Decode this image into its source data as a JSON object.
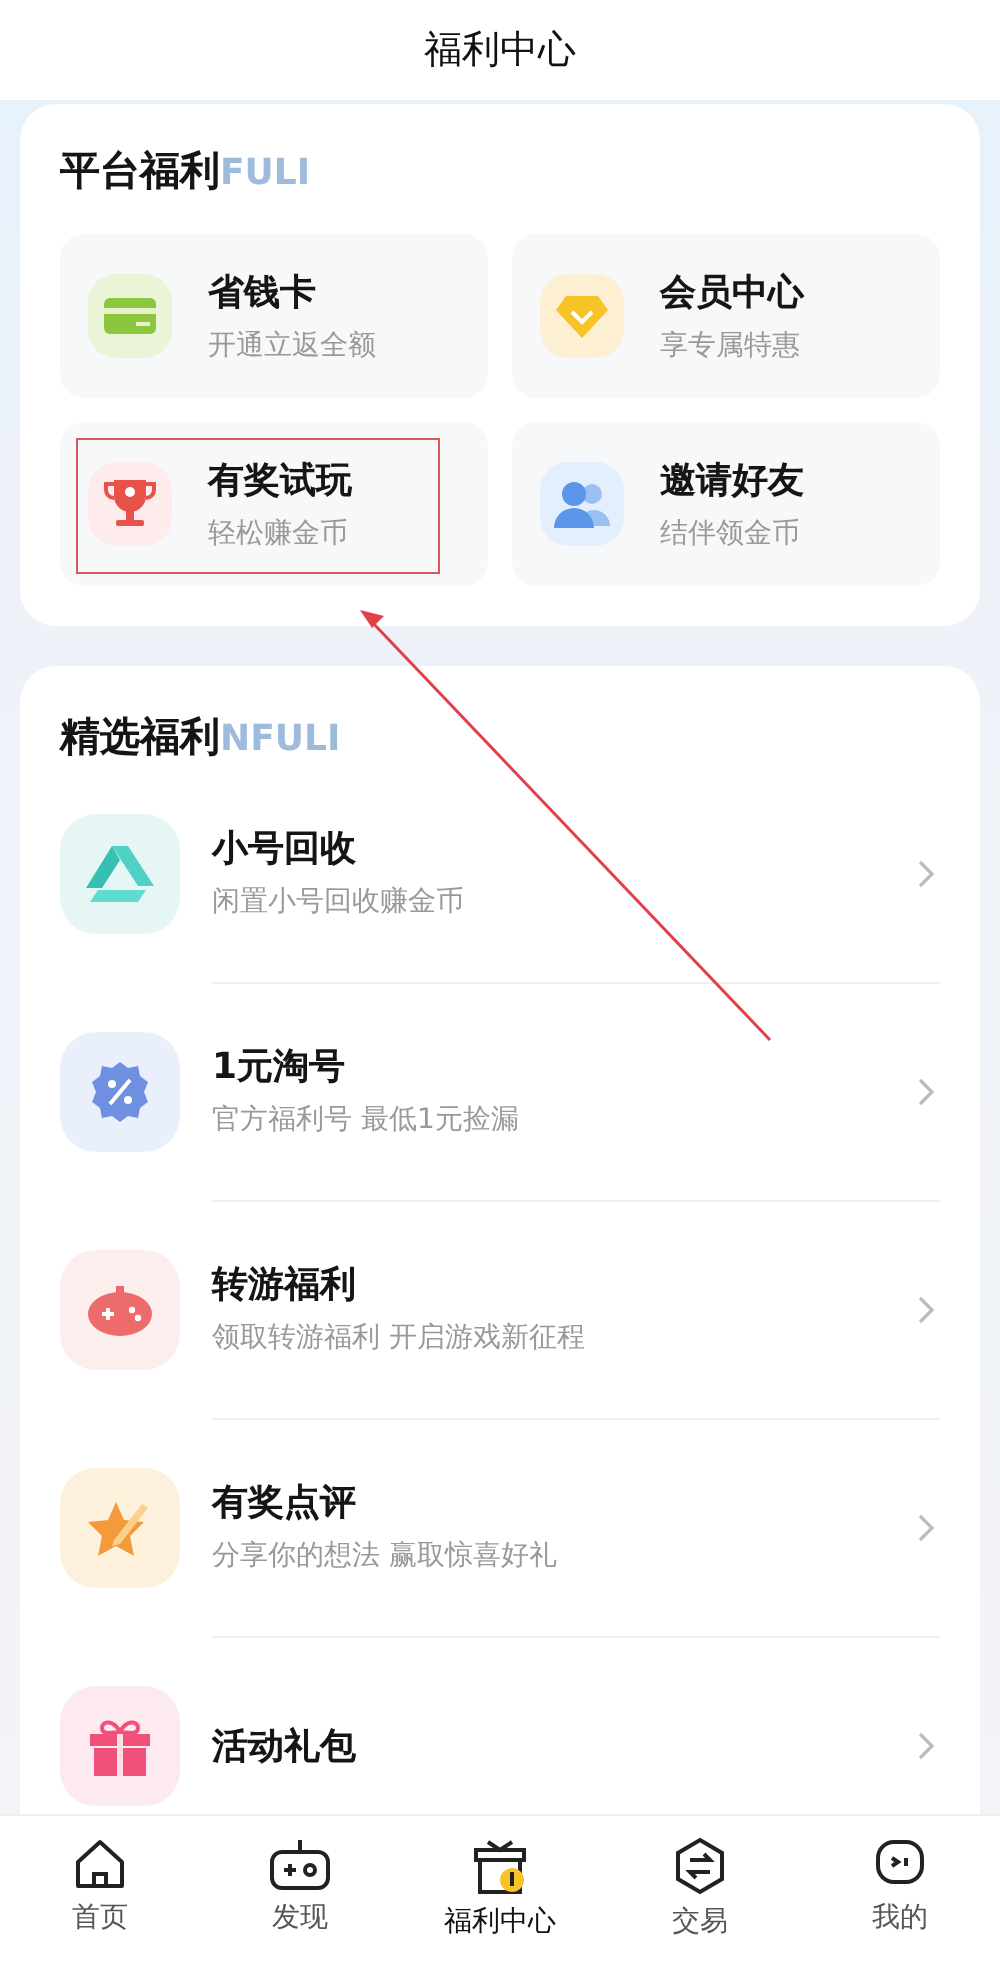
{
  "window": {
    "title": "福利中心"
  },
  "platform": {
    "heading": "平台福利",
    "heading_deco": "FULI",
    "tiles": [
      {
        "kind": "card",
        "title": "省钱卡",
        "subtitle": "开通立返全额",
        "highlighted": false
      },
      {
        "kind": "diamond",
        "title": "会员中心",
        "subtitle": "享专属特惠",
        "highlighted": false
      },
      {
        "kind": "trophy",
        "title": "有奖试玩",
        "subtitle": "轻松赚金币",
        "highlighted": true
      },
      {
        "kind": "people",
        "title": "邀请好友",
        "subtitle": "结伴领金币",
        "highlighted": false
      }
    ]
  },
  "featured": {
    "heading": "精选福利",
    "heading_deco": "NFULI",
    "items": [
      {
        "kind": "recycle",
        "title": "小号回收",
        "subtitle": "闲置小号回收赚金币"
      },
      {
        "kind": "percent",
        "title": "1元淘号",
        "subtitle": "官方福利号 最低1元捡漏"
      },
      {
        "kind": "gamepad",
        "title": "转游福利",
        "subtitle": "领取转游福利 开启游戏新征程"
      },
      {
        "kind": "star",
        "title": "有奖点评",
        "subtitle": "分享你的想法 赢取惊喜好礼"
      },
      {
        "kind": "gift",
        "title": "活动礼包"
      }
    ]
  },
  "tab_bar": [
    {
      "kind": "home",
      "label": "首页",
      "selected": false
    },
    {
      "kind": "discover",
      "label": "发现",
      "selected": false
    },
    {
      "kind": "welfare",
      "label": "福利中心",
      "selected": true
    },
    {
      "kind": "trade",
      "label": "交易",
      "selected": false
    },
    {
      "kind": "mine",
      "label": "我的",
      "selected": false
    }
  ]
}
